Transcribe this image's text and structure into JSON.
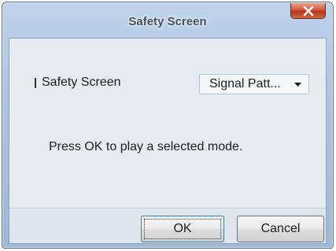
{
  "window": {
    "title": "Safety Screen"
  },
  "titlebar": {
    "close_icon": "close-x-icon"
  },
  "settings": {
    "label": "Safety Screen",
    "dropdown_value": "Signal Patt...",
    "dropdown_icon": "dropdown-arrow-icon"
  },
  "message": "Press OK to play a selected mode.",
  "buttons": {
    "ok_label": "OK",
    "cancel_label": "Cancel"
  },
  "colors": {
    "close_button": "#c94a2c",
    "title_text": "#4a4f57",
    "window_frame": "#a9c3de"
  }
}
